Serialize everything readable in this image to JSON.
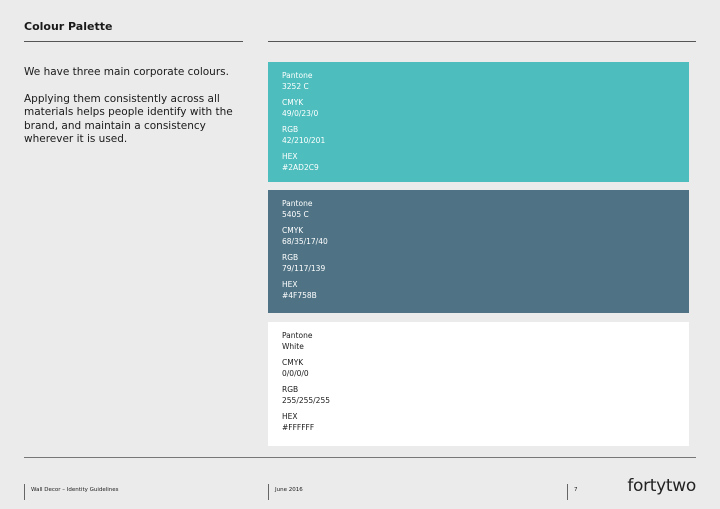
{
  "page": {
    "title": "Colour Palette",
    "intro": [
      "We have three main corporate colours.",
      "Applying them consistently across all materials helps people identify with the brand, and maintain a consistency wherever it is used."
    ]
  },
  "swatches": [
    {
      "color": "#4dbdbd",
      "text_color": "#ffffff",
      "pantone_label": "Pantone",
      "pantone": "3252 C",
      "cmyk_label": "CMYK",
      "cmyk": "49/0/23/0",
      "rgb_label": "RGB",
      "rgb": "42/210/201",
      "hex_label": "HEX",
      "hex": "#2AD2C9"
    },
    {
      "color": "#4f7385",
      "text_color": "#ffffff",
      "pantone_label": "Pantone",
      "pantone": "5405 C",
      "cmyk_label": "CMYK",
      "cmyk": "68/35/17/40",
      "rgb_label": "RGB",
      "rgb": "79/117/139",
      "hex_label": "HEX",
      "hex": "#4F758B"
    },
    {
      "color": "#ffffff",
      "text_color": "#1a1a1a",
      "pantone_label": "Pantone",
      "pantone": "White",
      "cmyk_label": "CMYK",
      "cmyk": "0/0/0/0",
      "rgb_label": "RGB",
      "rgb": "255/255/255",
      "hex_label": "HEX",
      "hex": "#FFFFFF"
    }
  ],
  "footer": {
    "document": "Wall Decor – Identity Guidelines",
    "date": "June 2016",
    "page_number": "7",
    "logo": "fortytwo"
  }
}
